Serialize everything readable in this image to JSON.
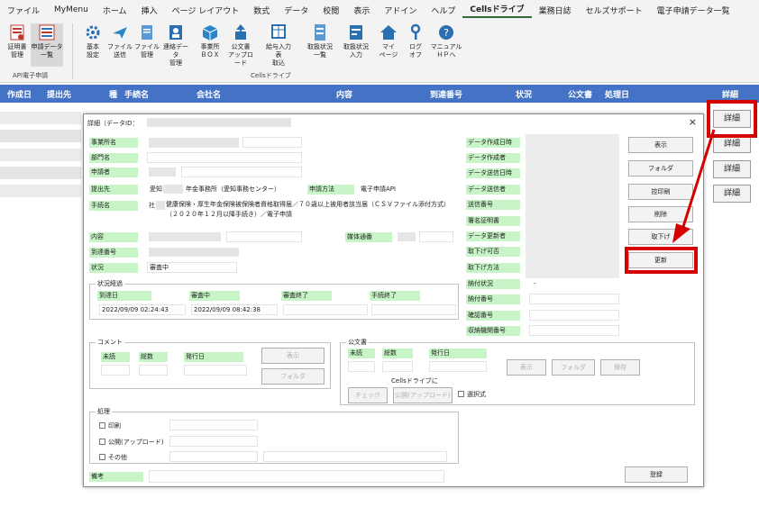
{
  "menu": [
    "ファイル",
    "MyMenu",
    "ホーム",
    "挿入",
    "ページ レイアウト",
    "数式",
    "データ",
    "校閲",
    "表示",
    "アドイン",
    "ヘルプ",
    "Cellsドライブ",
    "業務日誌",
    "セルズサポート",
    "電子申請データ一覧"
  ],
  "ribbon": {
    "group1_label": "API電子申請",
    "group2_label": "Cellsドライブ",
    "b1": "証明書\n管理",
    "b2": "申請データ\n一覧",
    "b3": "基本\n設定",
    "b4": "ファイル\n送信",
    "b5": "ファイル\n管理",
    "b6": "連絡データ\n管理",
    "b7": "事業所\nＢＯＸ",
    "b8": "公文書\nアップロード",
    "b9": "給与入力表\n取込",
    "b10": "取扱状況\n一覧",
    "b11": "取扱状況\n入力",
    "b12": "マイ\nページ",
    "b13": "ログ\nオフ",
    "b14": "マニュアル\nＨＰへ"
  },
  "table_header": {
    "c1": "作成日",
    "c2": "提出先",
    "c3": "種",
    "c4": "手続名",
    "c5": "会社名",
    "c6": "内容",
    "c7": "到達番号",
    "c8": "状況",
    "c9": "公文書",
    "c10": "処理日",
    "c11": "詳細"
  },
  "detail_button": "詳細",
  "dialog": {
    "title": "詳細（データID：",
    "close": "×",
    "left_labels": {
      "office": "事業所名",
      "dept": "部門名",
      "applicant": "申請者",
      "submit_to": "提出先",
      "procedure": "手続名",
      "content": "内容",
      "arrival_no": "到達番号",
      "status": "状況"
    },
    "submit_to_value": "愛知",
    "submit_to_value2": "年金事務所（愛知事務センター）",
    "method_label": "申請方法",
    "method_value": "電子申請API",
    "procedure_prefix": "社",
    "procedure_value": "健康保険・厚生年金保険被保険者資格取得届／７０歳以上被用者該当届（ＣＳＶファイル添付方式）（２０２０年１２月以降手続き）／電子申請",
    "media_label": "媒体通番",
    "status_value": "審査中",
    "right_labels": {
      "created_at": "データ作成日時",
      "creator": "データ作成者",
      "sent_at": "データ送信日時",
      "sender": "データ送信者",
      "send_no": "送信番号",
      "sig_cert": "署名証明書",
      "updater": "データ更新者",
      "withdraw_ok": "取下げ可否",
      "withdraw_method": "取下げ方法",
      "payment_status": "納付状況",
      "payment_no": "納付番号",
      "confirm_no": "確認番号",
      "org_no": "収納機関番号"
    },
    "payment_status_value": "-",
    "progress": {
      "legend": "状況経過",
      "h1": "到達日",
      "h2": "審査中",
      "h3": "審査終了",
      "h4": "手続終了",
      "v1": "2022/09/09 02:24:43",
      "v2": "2022/09/09 08:42:38"
    },
    "comment": {
      "legend": "コメント",
      "unread": "未読",
      "total": "総数",
      "issued": "発行日",
      "show": "表示",
      "folder": "フォルダ"
    },
    "official": {
      "legend": "公文書",
      "unread": "未読",
      "total": "総数",
      "issued": "発行日",
      "show": "表示",
      "folder": "フォルダ",
      "save": "保存",
      "cells_label": "Cellsドライブに",
      "check": "チェック",
      "upload": "公開(アップロード)",
      "select": "選択式"
    },
    "process": {
      "legend": "処理",
      "print": "印刷",
      "publish": "公開(アップロード)",
      "other": "その他"
    },
    "note_label": "備考",
    "buttons": {
      "show": "表示",
      "folder": "フォルダ",
      "control_print": "控印刷",
      "delete": "削除",
      "withdraw": "取下げ",
      "update": "更新",
      "register": "登録"
    }
  }
}
